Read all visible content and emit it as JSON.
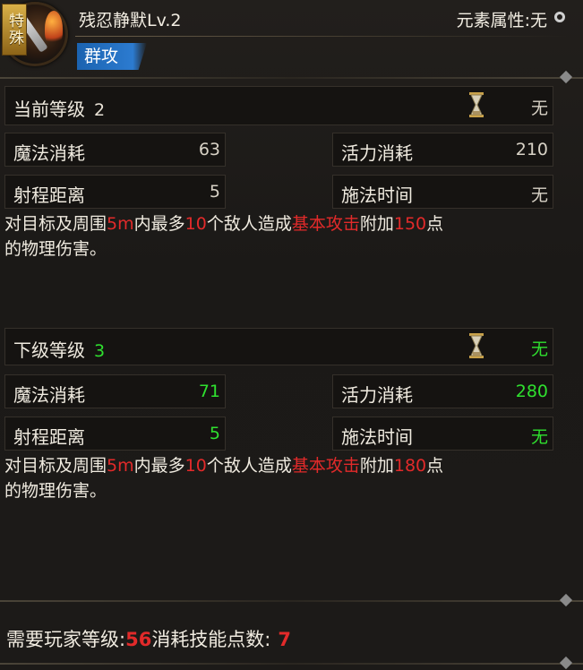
{
  "header": {
    "special_tag": "特殊",
    "skill_name": "残忍静默Lv.2",
    "element_attr": "元素属性:无",
    "skill_type": "群攻"
  },
  "current": {
    "level_label": "当前等级",
    "level": "2",
    "cast_value": "无",
    "mana_label": "魔法消耗",
    "mana": "63",
    "vigor_label": "活力消耗",
    "vigor": "210",
    "range_label": "射程距离",
    "range": "5",
    "cast_time_label": "施法时间",
    "cast_time": "无",
    "desc": {
      "p1": "对目标及周围",
      "radius": "5m",
      "p2": "内最多",
      "count": "10",
      "p3": "个敌人造成",
      "attack": "基本攻击",
      "p4": "附加",
      "bonus": "150",
      "p5": "点",
      "line2": "的物理伤害。"
    }
  },
  "next": {
    "level_label": "下级等级",
    "level": "3",
    "cast_value": "无",
    "mana_label": "魔法消耗",
    "mana": "71",
    "vigor_label": "活力消耗",
    "vigor": "280",
    "range_label": "射程距离",
    "range": "5",
    "cast_time_label": "施法时间",
    "cast_time": "无",
    "desc": {
      "p1": "对目标及周围",
      "radius": "5m",
      "p2": "内最多",
      "count": "10",
      "p3": "个敌人造成",
      "attack": "基本攻击",
      "p4": "附加",
      "bonus": "180",
      "p5": "点",
      "line2": "的物理伤害。"
    }
  },
  "footer": {
    "req_level_label": "需要玩家等级:",
    "req_level": "56",
    "skill_points_label": "消耗技能点数:",
    "skill_points": "7"
  },
  "colors": {
    "highlight_red": "#e22a2a",
    "next_level_green": "#2fe02f",
    "type_badge_blue": "#2c7bd0",
    "special_tag_gold": "#d9b048"
  },
  "icons": [
    "skill-icon",
    "special-tag",
    "element-circle-icon",
    "hourglass-icon"
  ]
}
